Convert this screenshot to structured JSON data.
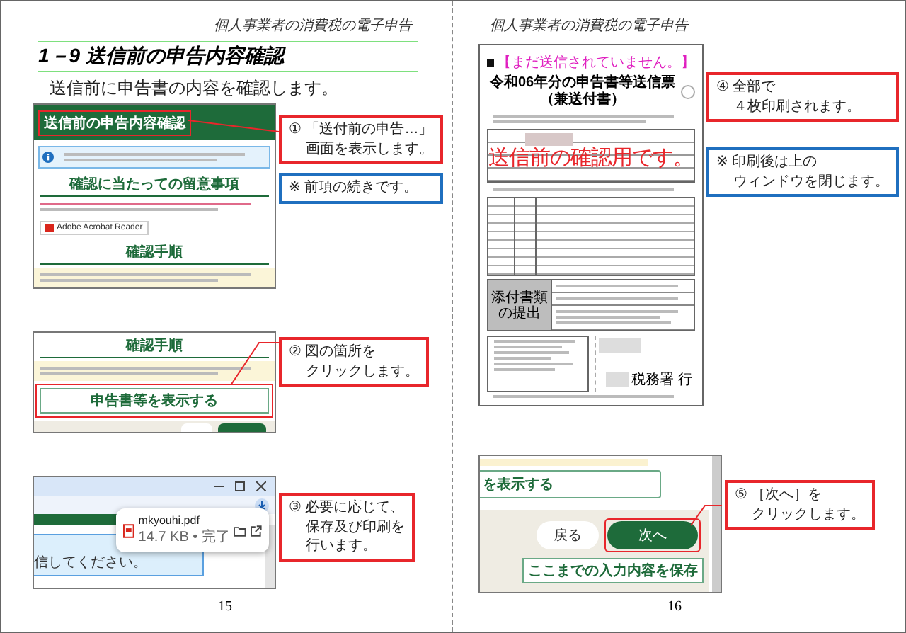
{
  "pages": [
    {
      "header": "個人事業者の消費税の電子申告",
      "title": "1－9 送信前の申告内容確認",
      "intro": "送信前に申告書の内容を確認します。",
      "figures": [
        {
          "kind": "notice-screen",
          "screen": {
            "header": "送信前の申告内容確認",
            "heading_1": "確認に当たっての留意事項",
            "badge": "Adobe Acrobat Reader",
            "heading_2": "確認手順"
          },
          "callouts": [
            {
              "lines": [
                "① 「送付前の申告…」",
                "画面を表示します。"
              ],
              "color": "#e8262b"
            },
            {
              "lines": [
                "※ 前項の続きです。"
              ],
              "color": "#1f6fbf"
            }
          ]
        },
        {
          "kind": "procedure-screen",
          "screen": {
            "heading": "確認手順",
            "button": "申告書等を表示する"
          },
          "callouts": [
            {
              "lines": [
                "② 図の箇所を",
                "クリックします。"
              ],
              "color": "#e8262b"
            }
          ]
        },
        {
          "kind": "download-screen",
          "screen": {
            "message": "信してください。",
            "file": "mkyouhi.pdf",
            "status": "14.7 KB • 完了"
          },
          "callouts": [
            {
              "lines": [
                "③ 必要に応じて、",
                "保存及び印刷を",
                "行います。"
              ],
              "color": "#e8262b"
            }
          ]
        }
      ],
      "page_number": "15"
    },
    {
      "header": "個人事業者の消費税の電子申告",
      "figures": [
        {
          "kind": "form-preview",
          "screen": {
            "notice": "【まだ送信されていません。】",
            "title": "令和06年分の申告書等送信票（兼送付書）",
            "overlay": "送信前の確認用です。",
            "attachments_label": "添付書類の提出",
            "addressee": "税務署 行"
          },
          "callouts": [
            {
              "lines": [
                "④ 全部で",
                "４枚印刷されます。"
              ],
              "color": "#e8262b"
            },
            {
              "lines": [
                "※ 印刷後は上の",
                "ウィンドウを閉じます。"
              ],
              "color": "#1f6fbf"
            }
          ]
        },
        {
          "kind": "nav-screen",
          "screen": {
            "link": "を表示する",
            "back": "戻る",
            "next": "次へ",
            "save": "ここまでの入力内容を保存"
          },
          "callouts": [
            {
              "lines": [
                "⑤ ［次へ］を",
                "クリックします。"
              ],
              "color": "#e8262b"
            }
          ]
        }
      ],
      "page_number": "16"
    }
  ]
}
